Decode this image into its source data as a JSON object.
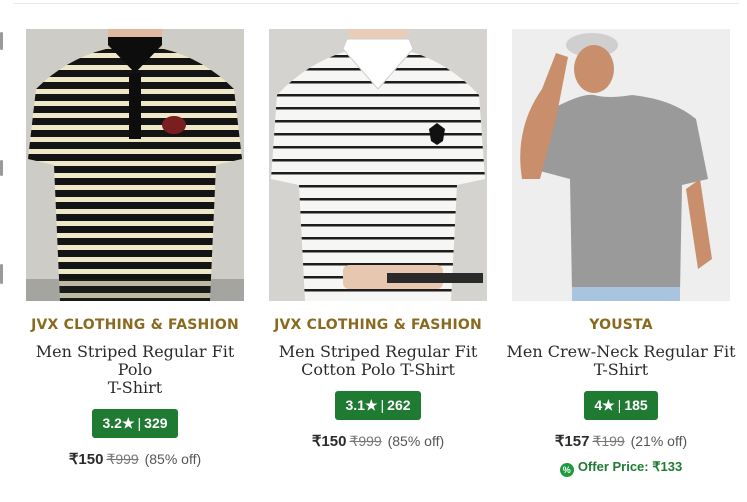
{
  "products": [
    {
      "brand": "JVX CLOTHING & FASHION",
      "title_line1": "Men Striped Regular Fit Polo",
      "title_line2": "T-Shirt",
      "rating": "3.2",
      "rating_star": "★",
      "rating_sep": "|",
      "reviews": "329",
      "price": "₹150",
      "mrp": "₹999",
      "discount": "(85% off)",
      "image": "model-black-cream-striped-polo"
    },
    {
      "brand": "JVX CLOTHING & FASHION",
      "title_line1": "Men Striped Regular Fit",
      "title_line2": "Cotton Polo T-Shirt",
      "rating": "3.1",
      "rating_star": "★",
      "rating_sep": "|",
      "reviews": "262",
      "price": "₹150",
      "mrp": "₹999",
      "discount": "(85% off)",
      "image": "model-white-black-striped-polo"
    },
    {
      "brand": "YOUSTA",
      "title_line1": "Men Crew-Neck Regular Fit",
      "title_line2": "T-Shirt",
      "rating": "4",
      "rating_star": "★",
      "rating_sep": "|",
      "reviews": "185",
      "price": "₹157",
      "mrp": "₹199",
      "discount": "(21% off)",
      "offer_icon": "%",
      "offer_text": "Offer Price: ₹133",
      "image": "model-grey-crew-neck-tee"
    }
  ],
  "colors": {
    "brand": "#8a6a1f",
    "rating_badge": "#1f7a32",
    "offer": "#1f7a32"
  }
}
